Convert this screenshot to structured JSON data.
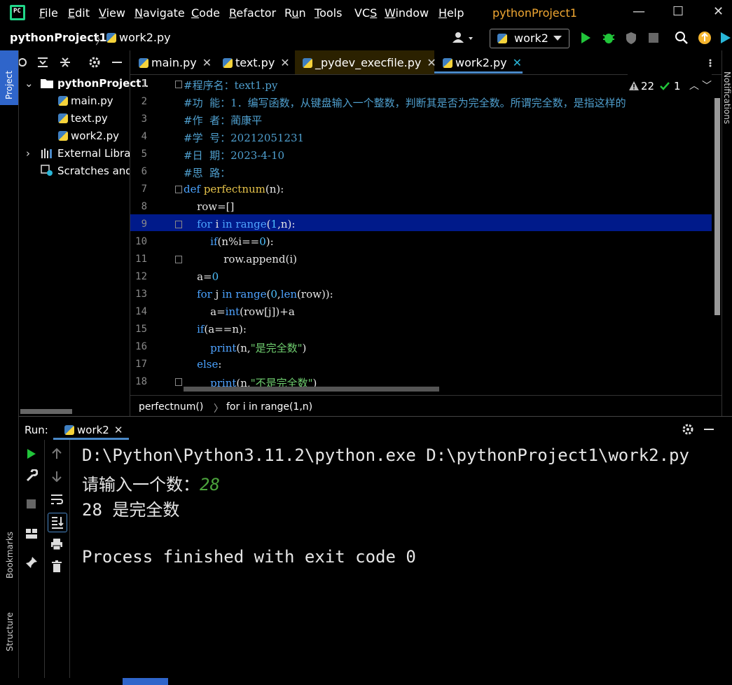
{
  "app": {
    "logo": "PC",
    "window_title": "pythonProject1"
  },
  "menu": [
    {
      "pre": "",
      "u": "F",
      "post": "ile"
    },
    {
      "pre": "",
      "u": "E",
      "post": "dit"
    },
    {
      "pre": "",
      "u": "V",
      "post": "iew"
    },
    {
      "pre": "",
      "u": "N",
      "post": "avigate"
    },
    {
      "pre": "",
      "u": "C",
      "post": "ode"
    },
    {
      "pre": "",
      "u": "R",
      "post": "efactor"
    },
    {
      "pre": "R",
      "u": "u",
      "post": "n"
    },
    {
      "pre": "",
      "u": "T",
      "post": "ools"
    },
    {
      "pre": "VC",
      "u": "S",
      "post": ""
    },
    {
      "pre": "",
      "u": "W",
      "post": "indow"
    },
    {
      "pre": "",
      "u": "H",
      "post": "elp"
    }
  ],
  "window_controls": {
    "minimize": "—",
    "maximize": "☐",
    "close": "✕"
  },
  "navbar": {
    "project": "pythonProject1",
    "separator": "〉",
    "file": "work2.py",
    "run_config": "work2"
  },
  "left_strip": {
    "project_tab": "Project",
    "bookmarks_tab": "Bookmarks",
    "structure_tab": "Structure"
  },
  "right_strip": {
    "notifications_tab": "Notifications"
  },
  "project_tree": {
    "root": "pythonProject1",
    "files": [
      "main.py",
      "text.py",
      "work2.py"
    ],
    "external": "External Libraries",
    "scratches": "Scratches and Consoles"
  },
  "editor_tabs": [
    {
      "label": "main.py"
    },
    {
      "label": "text.py"
    },
    {
      "label": "_pydev_execfile.py"
    },
    {
      "label": "work2.py"
    }
  ],
  "inspections": {
    "warnings": "22",
    "ok": "1"
  },
  "code_lines": [
    {
      "n": "1",
      "parts": [
        {
          "c": "cm",
          "t": "#程序名：text1.py"
        }
      ]
    },
    {
      "n": "2",
      "parts": [
        {
          "c": "cm",
          "t": "#功  能：1．编写函数，从键盘输入一个整数，判断其是否为完全数。所谓完全数，是指这样的"
        }
      ]
    },
    {
      "n": "3",
      "parts": [
        {
          "c": "cm",
          "t": "#作  者：蔺康平"
        }
      ]
    },
    {
      "n": "4",
      "parts": [
        {
          "c": "cm",
          "t": "#学  号：20212051231"
        }
      ]
    },
    {
      "n": "5",
      "parts": [
        {
          "c": "cm",
          "t": "#日  期：2023-4-10"
        }
      ]
    },
    {
      "n": "6",
      "parts": [
        {
          "c": "cm",
          "t": "#思  路："
        }
      ]
    },
    {
      "n": "7",
      "parts": [
        {
          "c": "kw",
          "t": "def "
        },
        {
          "c": "fn",
          "t": "perfectnum"
        },
        {
          "c": "",
          "t": "(n):"
        }
      ]
    },
    {
      "n": "8",
      "parts": [
        {
          "c": "",
          "t": "    row=[]"
        }
      ]
    },
    {
      "n": "9",
      "parts": [
        {
          "c": "kw",
          "t": "    for "
        },
        {
          "c": "",
          "t": "i "
        },
        {
          "c": "kw",
          "t": "in "
        },
        {
          "c": "bi",
          "t": "range"
        },
        {
          "c": "",
          "t": "("
        },
        {
          "c": "num",
          "t": "1"
        },
        {
          "c": "",
          "t": ",n):"
        }
      ]
    },
    {
      "n": "10",
      "parts": [
        {
          "c": "kw",
          "t": "        if"
        },
        {
          "c": "",
          "t": "(n%i=="
        },
        {
          "c": "num",
          "t": "0"
        },
        {
          "c": "",
          "t": "):"
        }
      ]
    },
    {
      "n": "11",
      "parts": [
        {
          "c": "",
          "t": "            row.append(i)"
        }
      ]
    },
    {
      "n": "12",
      "parts": [
        {
          "c": "",
          "t": "    a="
        },
        {
          "c": "num",
          "t": "0"
        }
      ]
    },
    {
      "n": "13",
      "parts": [
        {
          "c": "kw",
          "t": "    for "
        },
        {
          "c": "",
          "t": "j "
        },
        {
          "c": "kw",
          "t": "in "
        },
        {
          "c": "bi",
          "t": "range"
        },
        {
          "c": "",
          "t": "("
        },
        {
          "c": "num",
          "t": "0"
        },
        {
          "c": "",
          "t": ","
        },
        {
          "c": "bi",
          "t": "len"
        },
        {
          "c": "",
          "t": "(row)):"
        }
      ]
    },
    {
      "n": "14",
      "parts": [
        {
          "c": "",
          "t": "        a="
        },
        {
          "c": "bi",
          "t": "int"
        },
        {
          "c": "",
          "t": "(row[j])+a"
        }
      ]
    },
    {
      "n": "15",
      "parts": [
        {
          "c": "kw",
          "t": "    if"
        },
        {
          "c": "",
          "t": "(a==n):"
        }
      ]
    },
    {
      "n": "16",
      "parts": [
        {
          "c": "bi",
          "t": "        print"
        },
        {
          "c": "",
          "t": "(n,"
        },
        {
          "c": "str",
          "t": "\"是完全数\""
        },
        {
          "c": "",
          "t": ")"
        }
      ]
    },
    {
      "n": "17",
      "parts": [
        {
          "c": "kw",
          "t": "    else"
        },
        {
          "c": "",
          "t": ":"
        }
      ]
    },
    {
      "n": "18",
      "parts": [
        {
          "c": "bi",
          "t": "        print"
        },
        {
          "c": "",
          "t": "(n,"
        },
        {
          "c": "str",
          "t": "\"不是完全数\""
        },
        {
          "c": "",
          "t": ")"
        }
      ]
    }
  ],
  "editor_breadcrumb": {
    "item1": "perfectnum()",
    "sep": "〉",
    "item2": "for i in range(1,n)"
  },
  "run_panel": {
    "label": "Run:",
    "tab": "work2",
    "console": {
      "command": "D:\\Python\\Python3.11.2\\python.exe D:\\pythonProject1\\work2.py",
      "prompt": "请输入一个数：",
      "input": "28",
      "result": "28 是完全数",
      "exit": "Process finished with exit code 0"
    }
  },
  "colors": {
    "accent": "#2f65ca",
    "tab_underline": "#4a88c7",
    "title": "#f0a732",
    "current_line": "#001a8a",
    "run_green": "#21c53a"
  }
}
